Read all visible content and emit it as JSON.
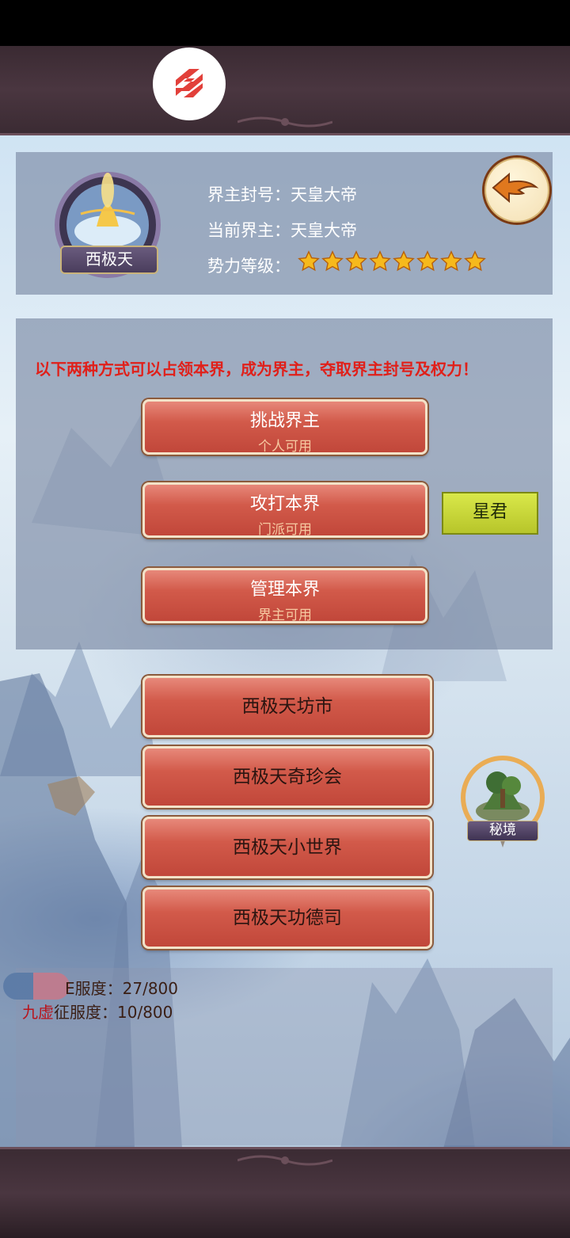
{
  "realm": {
    "emblem_name": "西极天",
    "lord_title_label": "界主封号：",
    "lord_title_value": "天皇大帝",
    "current_lord_label": "当前界主：",
    "current_lord_value": "天皇大帝",
    "power_level_label": "势力等级：",
    "power_level_stars": 8
  },
  "hint_text": "以下两种方式可以占领本界，成为界主，夺取界主封号及权力！",
  "actions": [
    {
      "label": "挑战界主",
      "sub": "个人可用"
    },
    {
      "label": "攻打本界",
      "sub": "门派可用"
    },
    {
      "label": "管理本界",
      "sub": "界主可用"
    }
  ],
  "rank_badge": "星君",
  "facilities": [
    {
      "label": "西极天坊市"
    },
    {
      "label": "西极天奇珍会"
    },
    {
      "label": "西极天小世界"
    },
    {
      "label": "西极天功德司"
    }
  ],
  "secret_realm_label": "秘境",
  "status": {
    "line1_label": "E服度：",
    "line1_value": "27/800",
    "line2_prefix": "九虚",
    "line2_label": "征服度：",
    "line2_value": "10/800"
  },
  "colors": {
    "hint": "#e0201a",
    "button_red": "#c1473a",
    "badge_green": "#c7d63a",
    "status_prefix": "#b8141c"
  },
  "icons": {
    "logo": "app-logo-icon",
    "back": "back-arrow-icon",
    "star": "star-icon"
  }
}
